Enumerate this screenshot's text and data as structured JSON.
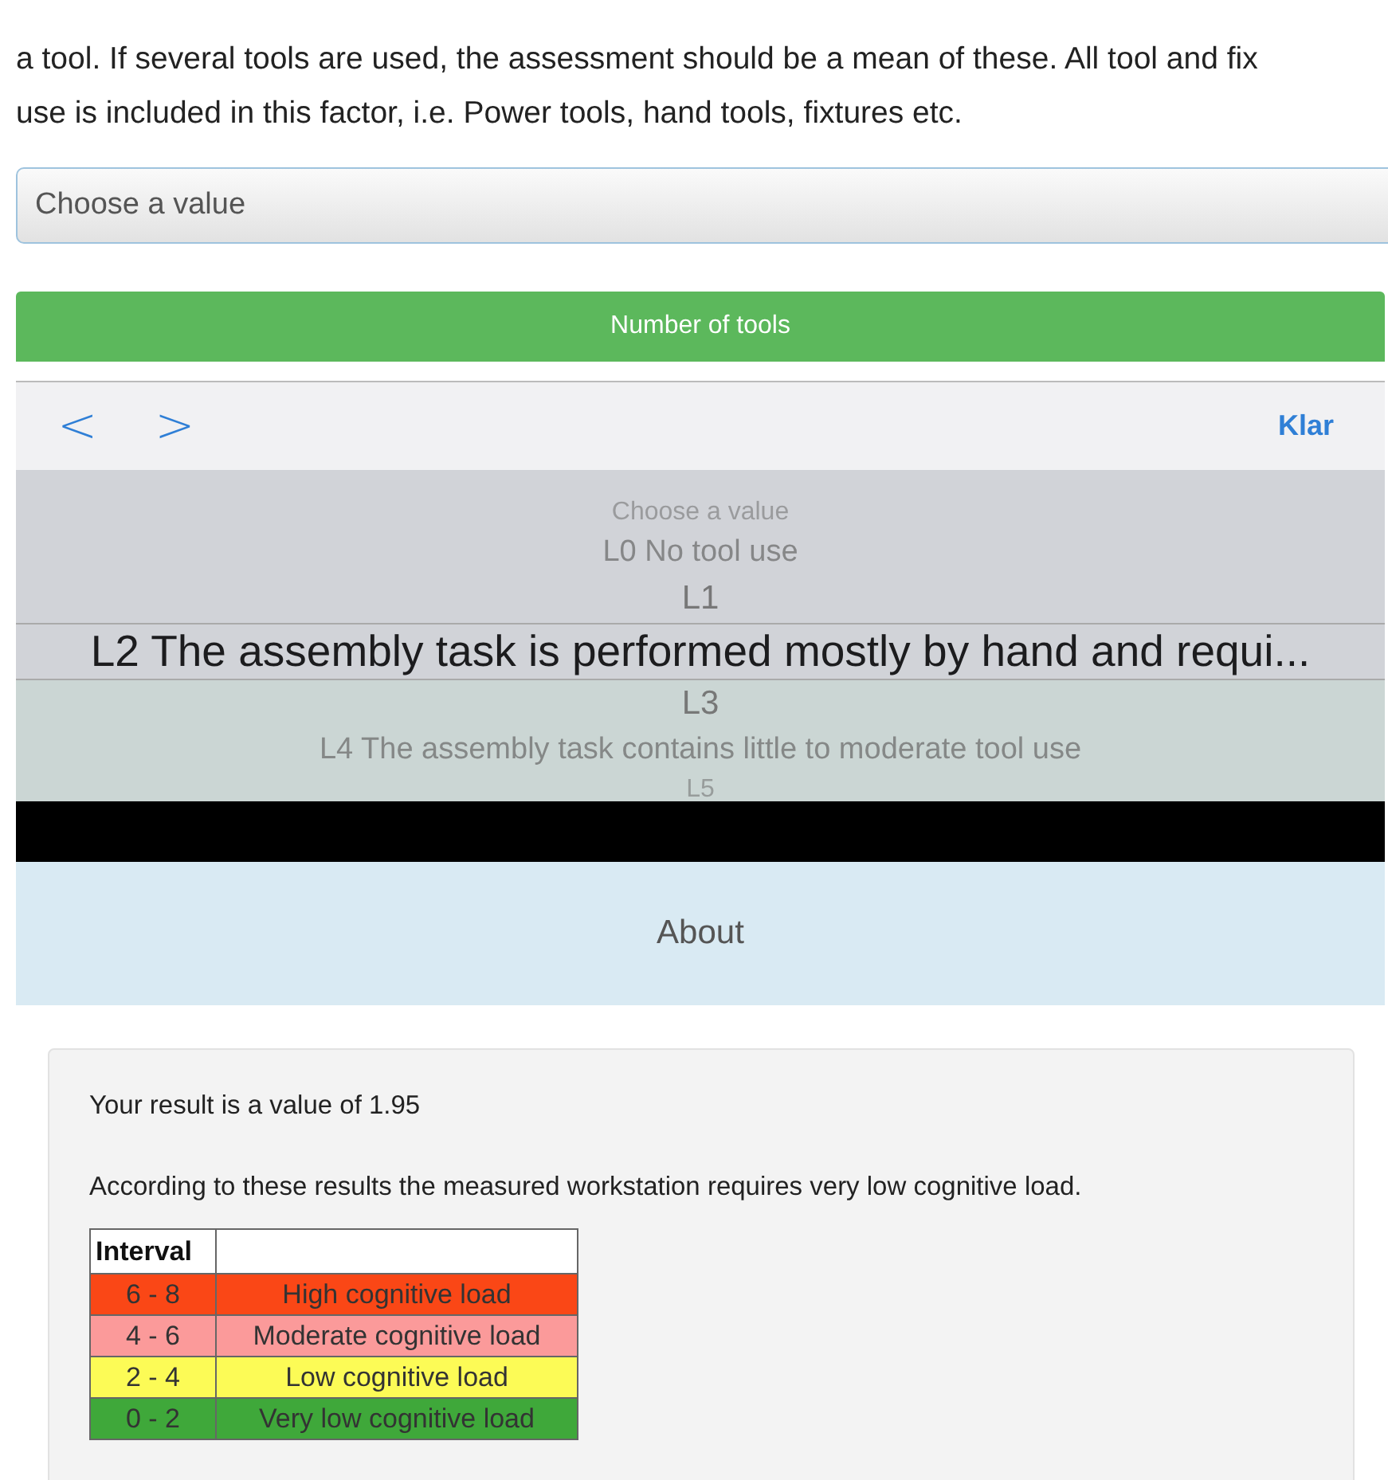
{
  "description": {
    "lines": [
      "a tool. If several tools are used, the assessment should be a mean of these. All tool and fix",
      "use is included in this factor, i.e. Power tools, hand tools, fixtures etc."
    ]
  },
  "select": {
    "placeholder": "Choose a value"
  },
  "section_button": {
    "label": "Number of tools"
  },
  "picker_toolbar": {
    "prev": "<",
    "next": ">",
    "done": "Klar"
  },
  "picker_items": [
    {
      "label": "Choose a value",
      "selected": false
    },
    {
      "label": "L0 No tool use",
      "selected": false
    },
    {
      "label": "L1",
      "selected": false
    },
    {
      "label": "L2 The assembly task is performed mostly by hand and requi...",
      "selected": true
    },
    {
      "label": "L3",
      "selected": false
    },
    {
      "label": "L4 The assembly task contains little to moderate tool use",
      "selected": false
    },
    {
      "label": "L5",
      "selected": false
    }
  ],
  "about": {
    "label": "About"
  },
  "result": {
    "value_text": "Your result is a value of 1.95",
    "conclusion": "According to these results the measured workstation requires very low cognitive load.",
    "table": {
      "columns": [
        "Interval",
        ""
      ],
      "rows": [
        {
          "interval": "6 - 8",
          "level": "High cognitive load",
          "color": "#fa4716"
        },
        {
          "interval": "4 - 6",
          "level": "Moderate cognitive load",
          "color": "#fb9a9a"
        },
        {
          "interval": "2 - 4",
          "level": "Low cognitive load",
          "color": "#fcfb56"
        },
        {
          "interval": "0 - 2",
          "level": "Very low cognitive load",
          "color": "#3fa83a"
        }
      ]
    }
  }
}
